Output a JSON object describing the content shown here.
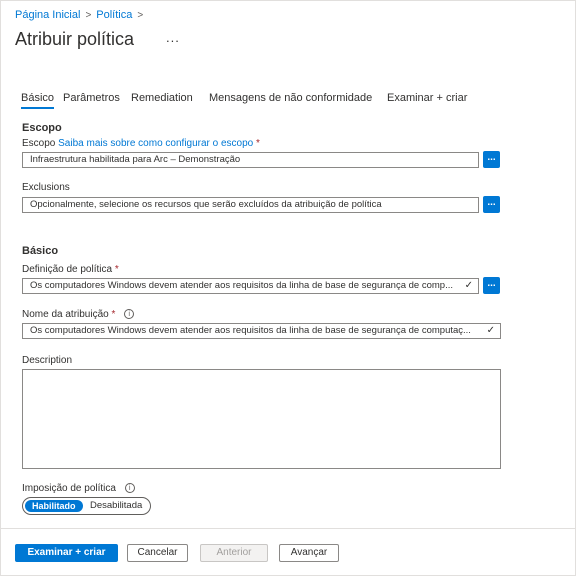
{
  "breadcrumb": {
    "home": "Página Inicial",
    "policy": "Política",
    "sep": ">"
  },
  "title": "Atribuir política",
  "more": "...",
  "tabs": [
    "Básico",
    "Parâmetros",
    "Remediation",
    "Mensagens de não conformidade",
    "Examinar + criar"
  ],
  "scope": {
    "section_title": "Escopo",
    "label": "Escopo",
    "link": "Saiba mais sobre como configurar o escopo",
    "required": "*",
    "value": "Infraestrutura habilitada para Arc – Demonstração",
    "browse": "..."
  },
  "exclusions": {
    "label": "Exclusions",
    "placeholder": "Opcionalmente, selecione os recursos que serão excluídos da atribuição de política",
    "browse": "..."
  },
  "basics": {
    "section_title": "Básico",
    "definition_label": "Definição de política",
    "required": "*",
    "definition_value": "Os computadores Windows devem atender aos requisitos da linha de base de segurança de comp...",
    "definition_browse": "...",
    "assignment_label": "Nome da atribuição",
    "assignment_value": "Os computadores Windows devem atender aos requisitos da linha de base de segurança de computaç...",
    "description_label": "Description",
    "description_value": "",
    "enforcement_label": "Imposição de política",
    "enforcement_on": "Habilitado",
    "enforcement_off": "Desabilitada",
    "info": "i",
    "check": "✓"
  },
  "footer": {
    "review_create": "Examinar + criar",
    "cancel": "Cancelar",
    "previous": "Anterior",
    "next": "Avançar"
  },
  "colors": {
    "accent": "#0078d4",
    "required": "#a4262c",
    "border": "#8a8886"
  }
}
